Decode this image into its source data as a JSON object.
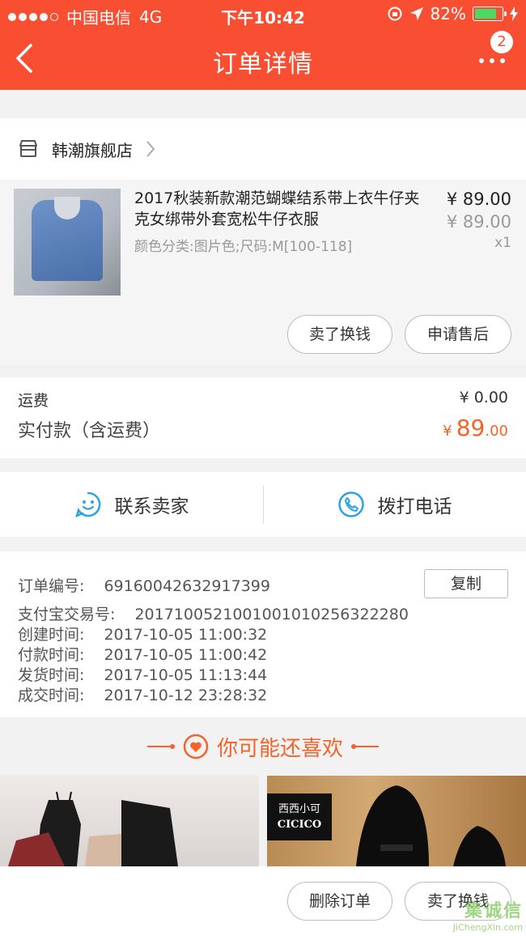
{
  "status_bar": {
    "carrier": "中国电信",
    "network": "4G",
    "time": "下午10:42",
    "battery": "82%"
  },
  "nav": {
    "title": "订单详情",
    "badge_count": "2"
  },
  "shop": {
    "name": "韩潮旗舰店"
  },
  "product": {
    "title": "2017秋装新款潮范蝴蝶结系带上衣牛仔夹克女绑带外套宽松牛仔衣服",
    "spec": "颜色分类:图片色;尺码:M[100-118]",
    "price": "¥ 89.00",
    "original_price": "¥ 89.00",
    "quantity": "x1",
    "actions": [
      "卖了换钱",
      "申请售后"
    ]
  },
  "fees": {
    "shipping_label": "运费",
    "shipping_value": "¥ 0.00",
    "paid_label": "实付款（含运费）",
    "paid_currency": "¥",
    "paid_integer": "89",
    "paid_decimal": ".00"
  },
  "contact": {
    "seller_label": "联系卖家",
    "call_label": "拨打电话"
  },
  "order_info": {
    "order_no_label": "订单编号:",
    "order_no": "69160042632917399",
    "copy_label": "复制",
    "alipay_label": "支付宝交易号:",
    "alipay_no": "2017100521001001010256322280",
    "created_label": "创建时间:",
    "created_time": "2017-10-05 11:00:32",
    "paid_label": "付款时间:",
    "paid_time": "2017-10-05 11:00:42",
    "shipped_label": "发货时间:",
    "shipped_time": "2017-10-05 11:13:44",
    "done_label": "成交时间:",
    "done_time": "2017-10-12 23:28:32"
  },
  "recommend": {
    "title": "你可能还喜欢",
    "brand_cn": "西西小可",
    "brand_en": "CICICO"
  },
  "bottom_actions": [
    "删除订单",
    "卖了换钱"
  ],
  "watermark": {
    "text": "JiChengXin.com",
    "logo": "集诚信"
  },
  "colors": {
    "accent": "#f84e32",
    "price_orange": "#f5632a",
    "icon_blue": "#29a3e6"
  }
}
